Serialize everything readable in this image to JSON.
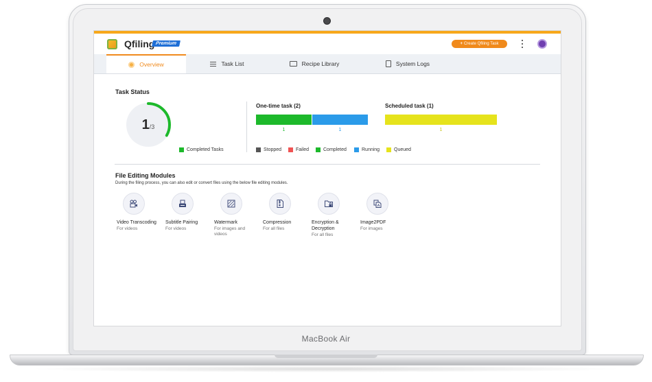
{
  "device": {
    "brand_label": "MacBook Air"
  },
  "app": {
    "name": "Qfiling",
    "badge": "Premium",
    "create_button": "Create Qfiling Task",
    "accent_color": "#f7a81b"
  },
  "tabs": [
    {
      "label": "Overview",
      "active": true
    },
    {
      "label": "Task List",
      "active": false
    },
    {
      "label": "Recipe Library",
      "active": false
    },
    {
      "label": "System Logs",
      "active": false
    }
  ],
  "task_status": {
    "title": "Task Status",
    "completed": "1",
    "total": "/3",
    "completed_fraction": 0.333,
    "donut_legend": "Completed Tasks",
    "one_time": {
      "title": "One-time task (2)",
      "segments": [
        {
          "status": "Completed",
          "value": "1",
          "color": "#1db92b"
        },
        {
          "status": "Running",
          "value": "1",
          "color": "#2b9be9"
        }
      ]
    },
    "scheduled": {
      "title": "Scheduled task (1)",
      "segments": [
        {
          "status": "Queued",
          "value": "1",
          "color": "#e6e31c"
        }
      ]
    },
    "legend": [
      {
        "label": "Stopped",
        "color": "#555555"
      },
      {
        "label": "Failed",
        "color": "#f05454"
      },
      {
        "label": "Completed",
        "color": "#1db92b"
      },
      {
        "label": "Running",
        "color": "#2b9be9"
      },
      {
        "label": "Queued",
        "color": "#e6e31c"
      }
    ]
  },
  "modules": {
    "title": "File Editing Modules",
    "description": "During the filing process, you can also edit or convert files using the below file editing modules.",
    "items": [
      {
        "name": "Video Transcoding",
        "sub": "For videos",
        "icon": "video-camera-icon"
      },
      {
        "name": "Subtitle Pairing",
        "sub": "For videos",
        "icon": "subtitle-icon"
      },
      {
        "name": "Watermark",
        "sub": "For images and videos",
        "icon": "watermark-icon"
      },
      {
        "name": "Compression",
        "sub": "For all files",
        "icon": "zip-icon"
      },
      {
        "name": "Encryption & Decryption",
        "sub": "For all files",
        "icon": "folder-lock-icon"
      },
      {
        "name": "Image2PDF",
        "sub": "For images",
        "icon": "pdf-icon"
      }
    ]
  }
}
